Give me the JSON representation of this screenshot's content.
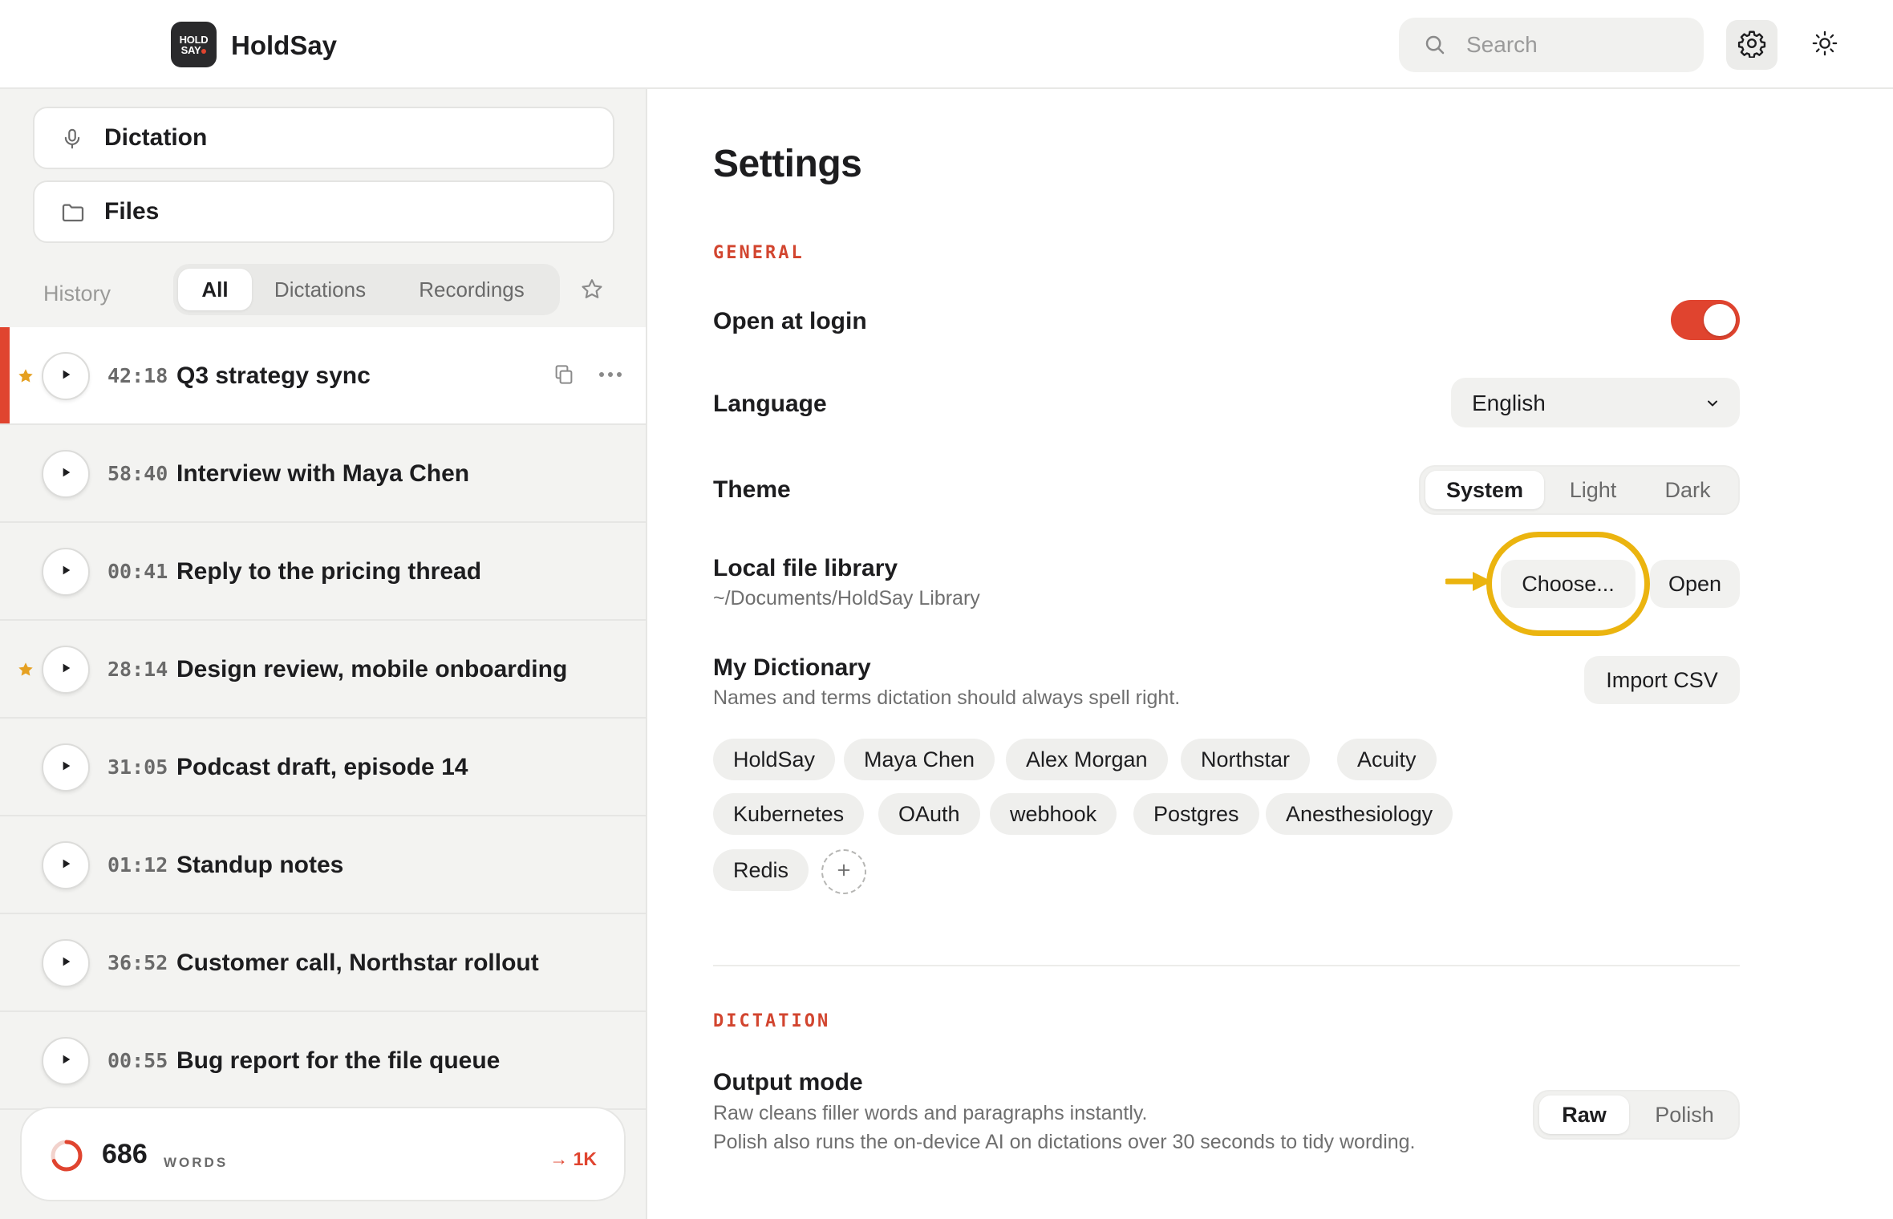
{
  "app": {
    "name": "HoldSay",
    "logo_text_line1": "HOLD",
    "logo_text_line2": "SAY",
    "accent_color": "#e0442f",
    "highlight_color": "#ebb40f"
  },
  "header": {
    "search_placeholder": "Search",
    "settings_icon": "gear-icon",
    "theme_icon": "sun-icon"
  },
  "sidebar": {
    "nav": [
      {
        "label": "Dictation",
        "icon": "microphone-icon"
      },
      {
        "label": "Files",
        "icon": "folder-icon"
      }
    ],
    "history_label": "History",
    "filters": [
      "All",
      "Dictations",
      "Recordings"
    ],
    "active_filter": "All",
    "items": [
      {
        "duration": "42:18",
        "title": "Q3 strategy sync",
        "starred": true,
        "selected": true
      },
      {
        "duration": "58:40",
        "title": "Interview with Maya Chen",
        "starred": false
      },
      {
        "duration": "00:41",
        "title": "Reply to the pricing thread",
        "starred": false
      },
      {
        "duration": "28:14",
        "title": "Design review, mobile onboarding",
        "starred": true
      },
      {
        "duration": "31:05",
        "title": "Podcast draft, episode 14",
        "starred": false
      },
      {
        "duration": "01:12",
        "title": "Standup notes",
        "starred": false
      },
      {
        "duration": "36:52",
        "title": "Customer call, Northstar rollout",
        "starred": false
      },
      {
        "duration": "00:55",
        "title": "Bug report for the file queue",
        "starred": false
      }
    ],
    "words": {
      "count": "686",
      "unit": "WORDS",
      "goal": "→ 1K",
      "progress": 0.686
    }
  },
  "settings": {
    "title": "Settings",
    "general": {
      "label": "GENERAL",
      "open_at_login": {
        "title": "Open at login",
        "enabled": true
      },
      "language": {
        "title": "Language",
        "value": "English"
      },
      "theme": {
        "title": "Theme",
        "options": [
          "System",
          "Light",
          "Dark"
        ],
        "selected": "System"
      },
      "library": {
        "title": "Local file library",
        "path": "~/Documents/HoldSay Library",
        "choose_label": "Choose...",
        "open_label": "Open"
      },
      "dictionary": {
        "title": "My Dictionary",
        "description": "Names and terms dictation should always spell right.",
        "import_label": "Import CSV",
        "terms": [
          "HoldSay",
          "Maya Chen",
          "Alex Morgan",
          "Northstar",
          "Acuity",
          "Kubernetes",
          "OAuth",
          "webhook",
          "Postgres",
          "Anesthesiology",
          "Redis"
        ]
      }
    },
    "dictation": {
      "label": "DICTATION",
      "output_mode": {
        "title": "Output mode",
        "description_1": "Raw cleans filler words and paragraphs instantly.",
        "description_2": "Polish also runs the on-device AI on dictations over 30 seconds to tidy wording.",
        "options": [
          "Raw",
          "Polish"
        ],
        "selected": "Raw"
      }
    }
  }
}
